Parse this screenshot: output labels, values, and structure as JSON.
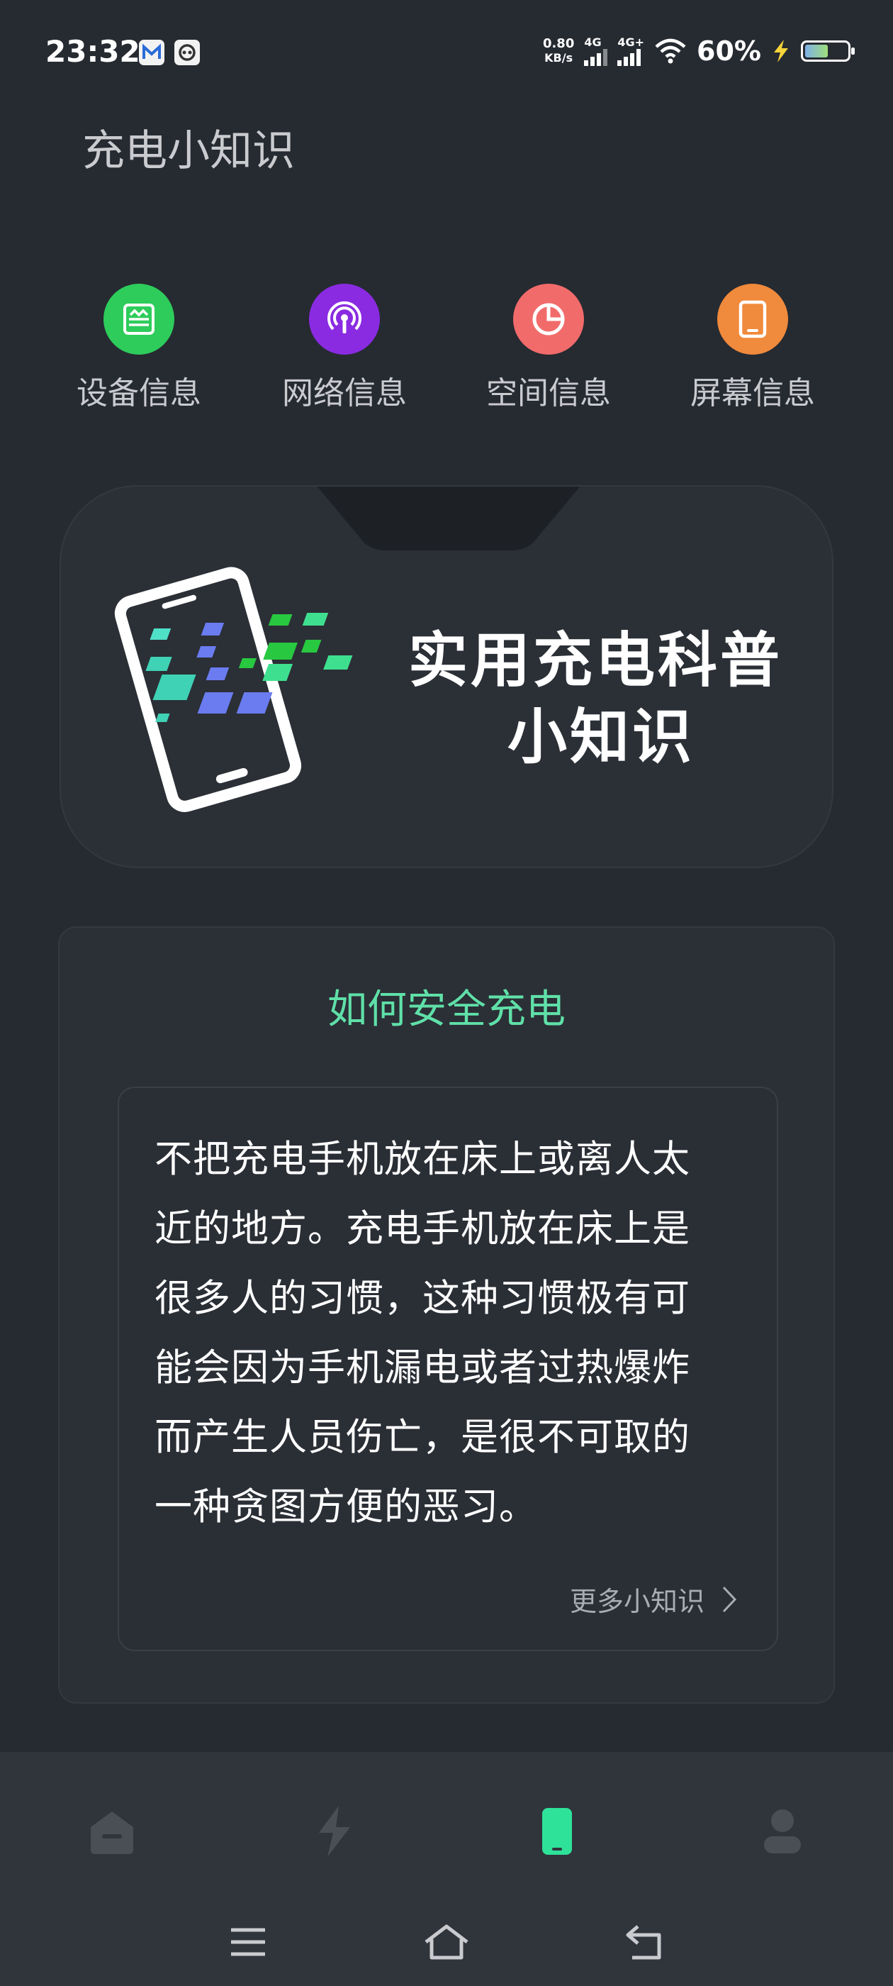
{
  "status_bar": {
    "time": "23:32",
    "net_speed_value": "0.80",
    "net_speed_unit": "KB/s",
    "sim1_tag": "4G",
    "sim2_tag": "4G+",
    "battery_percent": "60%",
    "battery_level": 0.6,
    "notifications": [
      "mail-icon",
      "game-controller-icon"
    ]
  },
  "header": {
    "title": "充电小知识"
  },
  "quick_menu": [
    {
      "label": "设备信息",
      "icon": "device-info-icon",
      "color": "#2ecc5b"
    },
    {
      "label": "网络信息",
      "icon": "network-podcast-icon",
      "color": "#8a2be2"
    },
    {
      "label": "空间信息",
      "icon": "pie-chart-icon",
      "color": "#f26b6b"
    },
    {
      "label": "屏幕信息",
      "icon": "tablet-icon",
      "color": "#f08a3c"
    }
  ],
  "banner": {
    "title_line1": "实用充电科普",
    "title_line2": "小知识"
  },
  "tip": {
    "title": "如何安全充电",
    "lines": [
      "不把充电手机放在床上或离人太",
      "近的地方。充电手机放在床上是",
      "很多人的习惯，这种习惯极有可",
      "能会因为手机漏电或者过热爆炸",
      "而产生人员伤亡，是很不可取的",
      "一种贪图方便的恶习。"
    ],
    "more_label": "更多小知识"
  },
  "bottom_nav": {
    "items": [
      "home-icon",
      "lightning-icon",
      "phone-icon",
      "user-icon"
    ],
    "active_index": 2,
    "active_color": "#2ee29a"
  },
  "system_bar": [
    "menu-icon",
    "home-outline-icon",
    "back-icon"
  ]
}
